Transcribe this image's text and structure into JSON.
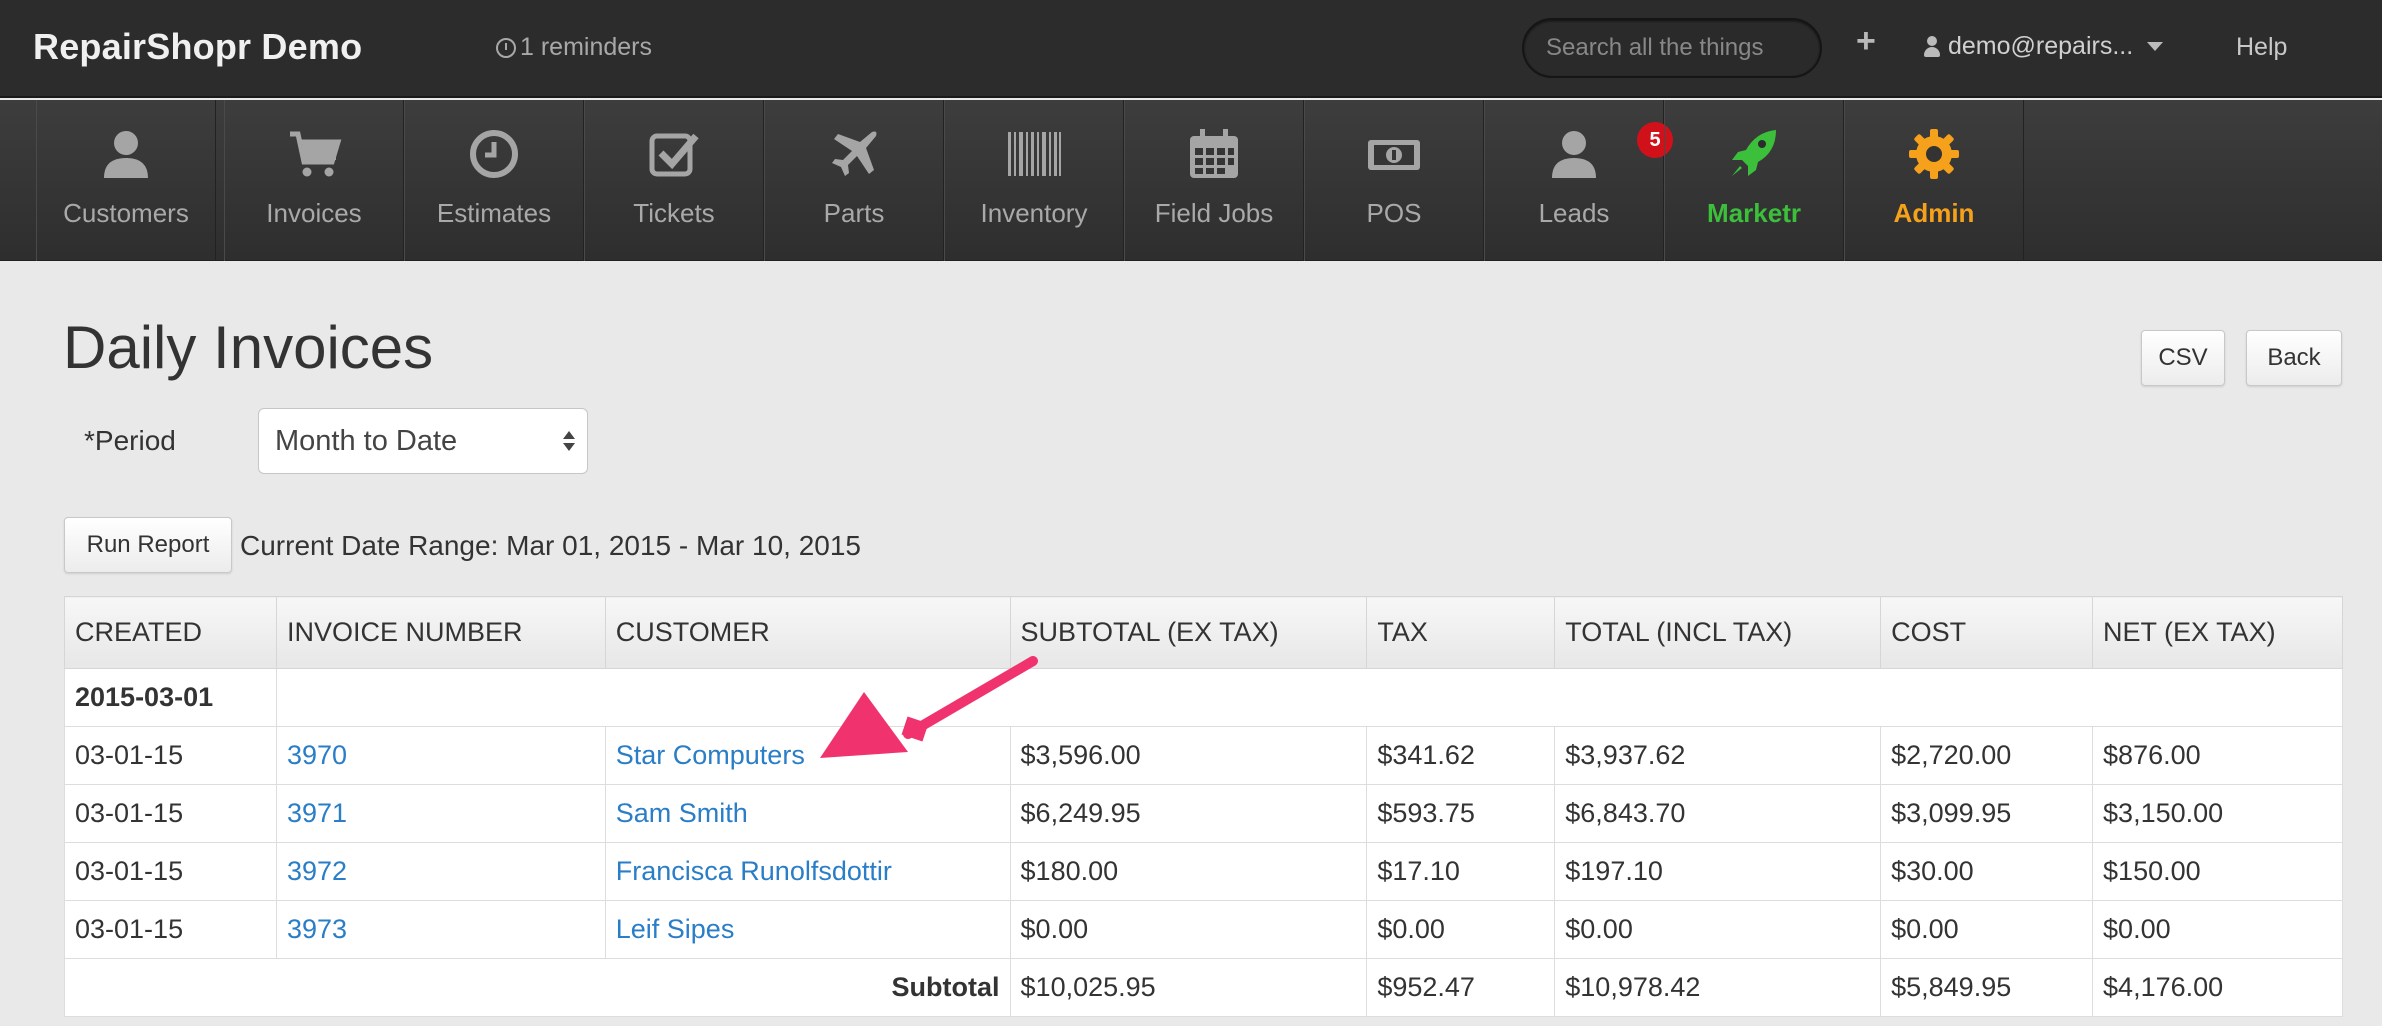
{
  "app": {
    "title": "RepairShopr Demo",
    "reminders": "1 reminders"
  },
  "header": {
    "search_placeholder": "Search all the things",
    "plus": "+",
    "user": "demo@repairs...",
    "help": "Help"
  },
  "nav": [
    {
      "label": "Customers",
      "icon": "user-icon"
    },
    {
      "label": "Invoices",
      "icon": "cart-icon"
    },
    {
      "label": "Estimates",
      "icon": "clock-icon"
    },
    {
      "label": "Tickets",
      "icon": "checkbox-icon"
    },
    {
      "label": "Parts",
      "icon": "plane-icon"
    },
    {
      "label": "Inventory",
      "icon": "barcode-icon"
    },
    {
      "label": "Field Jobs",
      "icon": "calendar-icon"
    },
    {
      "label": "POS",
      "icon": "money-icon"
    },
    {
      "label": "Leads",
      "icon": "user-icon",
      "badge": "5"
    },
    {
      "label": "Marketr",
      "icon": "rocket-icon",
      "color": "#3cc03c"
    },
    {
      "label": "Admin",
      "icon": "gear-icon",
      "color": "#f6a11b"
    }
  ],
  "page": {
    "title": "Daily Invoices",
    "csv": "CSV",
    "back": "Back",
    "period_label": "*Period",
    "period_value": "Month to Date",
    "run_report": "Run Report",
    "date_range": "Current Date Range: Mar 01, 2015 - Mar 10, 2015"
  },
  "table": {
    "headers": [
      "CREATED",
      "INVOICE NUMBER",
      "CUSTOMER",
      "SUBTOTAL (EX TAX)",
      "TAX",
      "TOTAL (INCL TAX)",
      "COST",
      "NET (EX TAX)"
    ],
    "group": "2015-03-01",
    "rows": [
      {
        "created": "03-01-15",
        "invoice": "3970",
        "customer": "Star Computers",
        "subtotal": "$3,596.00",
        "tax": "$341.62",
        "total": "$3,937.62",
        "cost": "$2,720.00",
        "net": "$876.00"
      },
      {
        "created": "03-01-15",
        "invoice": "3971",
        "customer": "Sam Smith",
        "subtotal": "$6,249.95",
        "tax": "$593.75",
        "total": "$6,843.70",
        "cost": "$3,099.95",
        "net": "$3,150.00"
      },
      {
        "created": "03-01-15",
        "invoice": "3972",
        "customer": "Francisca Runolfsdottir",
        "subtotal": "$180.00",
        "tax": "$17.10",
        "total": "$197.10",
        "cost": "$30.00",
        "net": "$150.00"
      },
      {
        "created": "03-01-15",
        "invoice": "3973",
        "customer": "Leif Sipes",
        "subtotal": "$0.00",
        "tax": "$0.00",
        "total": "$0.00",
        "cost": "$0.00",
        "net": "$0.00"
      }
    ],
    "subtotal": {
      "label": "Subtotal",
      "subtotal": "$10,025.95",
      "tax": "$952.47",
      "total": "$10,978.42",
      "cost": "$5,849.95",
      "net": "$4,176.00"
    }
  },
  "colors": {
    "link": "#2a7dc7",
    "annotation_arrow": "#f0336f",
    "badge": "#d0111a"
  }
}
